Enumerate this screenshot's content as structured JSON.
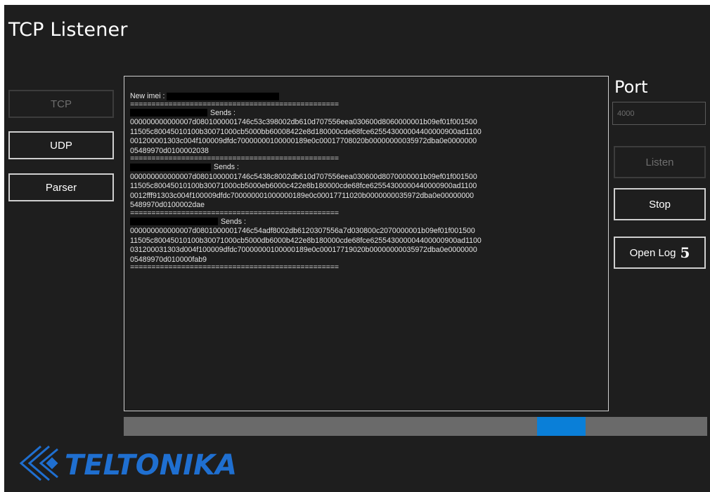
{
  "title": "TCP Listener",
  "nav": {
    "tcp": "TCP",
    "udp": "UDP",
    "parser": "Parser"
  },
  "log": {
    "imei_label": "New imei :",
    "separator": "=================================================",
    "sends_label": "Sends :",
    "messages": [
      [
        "000000000000007d0801000001746c53c398002db610d707556eea030600d8060000001b09ef01f001500",
        "11505c80045010100b30071000cb5000bb60008422e8d180000cde68fce625543000004400000900ad1100",
        "001200001303c004f100009dfdc70000000100000189e0c00017708020b00000000035972dba0e0000000",
        "05489970d0100002038"
      ],
      [
        "000000000000007d0801000001746c5438c8002db610d707556eea030600d8070000001b09ef01f001500",
        "11505c80045010100b30071000cb5000eb6000c422e8b180000cde68fce62554300000440000900ad1100",
        "0012fff91303c004f100009dfdc700000001000000189e0c00017711020b0000000035972dba0e00000000",
        "5489970d0100002dae"
      ],
      [
        "000000000000007d0801000001746c54adf8002db6120307556a7d030800c2070000001b09ef01f001500",
        "11505c80045010100b30071000cb5000db6000b422e8b180000cde68fce625543000004400000900ad1100",
        "031200031303d004f100009dfdc70000000100000189e0c00017719020b00000000035972dba0e0000000",
        "05489970d010000fab9"
      ]
    ]
  },
  "port": {
    "label": "Port",
    "value": "4000"
  },
  "buttons": {
    "listen": "Listen",
    "stop": "Stop",
    "open_log": "Open Log",
    "open_log_badge": "5"
  },
  "progress": {
    "start_fraction": 0.708,
    "end_fraction": 0.792
  },
  "logo_text": "TELTONIKA",
  "colors": {
    "background": "#1e1e1e",
    "accent": "#0a7fd8",
    "logo": "#1f6fd0"
  }
}
